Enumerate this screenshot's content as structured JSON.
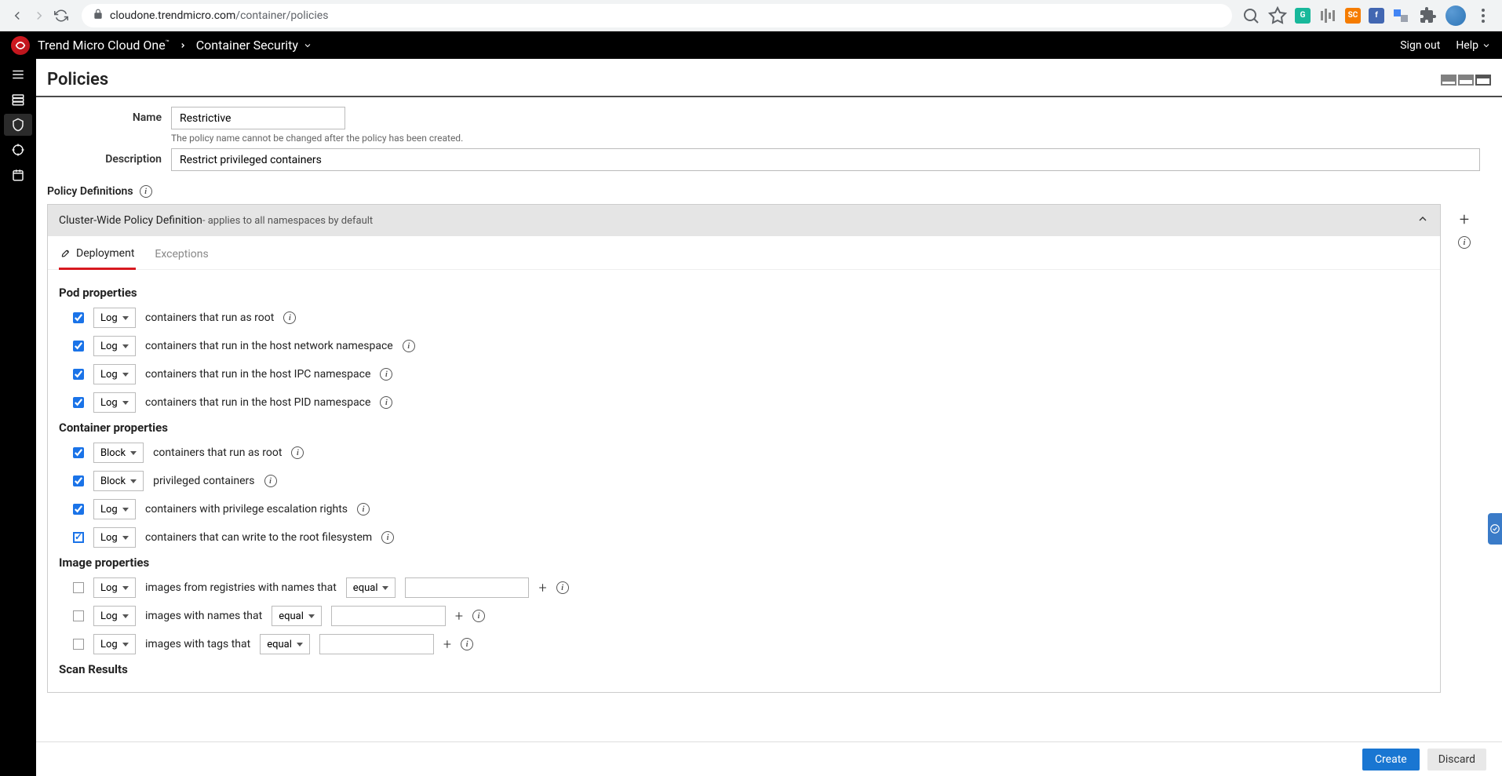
{
  "browser": {
    "url_host": "cloudone.trendmicro.com",
    "url_path": "/container/policies"
  },
  "header": {
    "brand": "Trend Micro Cloud One",
    "module": "Container Security",
    "sign_out": "Sign out",
    "help": "Help"
  },
  "page": {
    "title": "Policies"
  },
  "form": {
    "name_label": "Name",
    "name_value": "Restrictive",
    "name_hint": "The policy name cannot be changed after the policy has been created.",
    "desc_label": "Description",
    "desc_value": "Restrict privileged containers",
    "defs_label": "Policy Definitions"
  },
  "cluster": {
    "title": "Cluster-Wide Policy Definition",
    "subtitle": " - applies to all namespaces by default"
  },
  "tabs": {
    "deployment": "Deployment",
    "exceptions": "Exceptions"
  },
  "sections": {
    "pod": "Pod properties",
    "container": "Container properties",
    "image": "Image properties",
    "scan": "Scan Results"
  },
  "actions": {
    "log": "Log",
    "block": "Block",
    "equal": "equal"
  },
  "rules": {
    "pod": [
      "containers that run as root",
      "containers that run in the host network namespace",
      "containers that run in the host IPC namespace",
      "containers that run in the host PID namespace"
    ],
    "container": [
      "containers that run as root",
      "privileged containers",
      "containers with privilege escalation rights",
      "containers that can write to the root filesystem"
    ],
    "image": [
      "images from registries with names that",
      "images with names that",
      "images with tags that"
    ]
  },
  "footer": {
    "create": "Create",
    "discard": "Discard"
  }
}
